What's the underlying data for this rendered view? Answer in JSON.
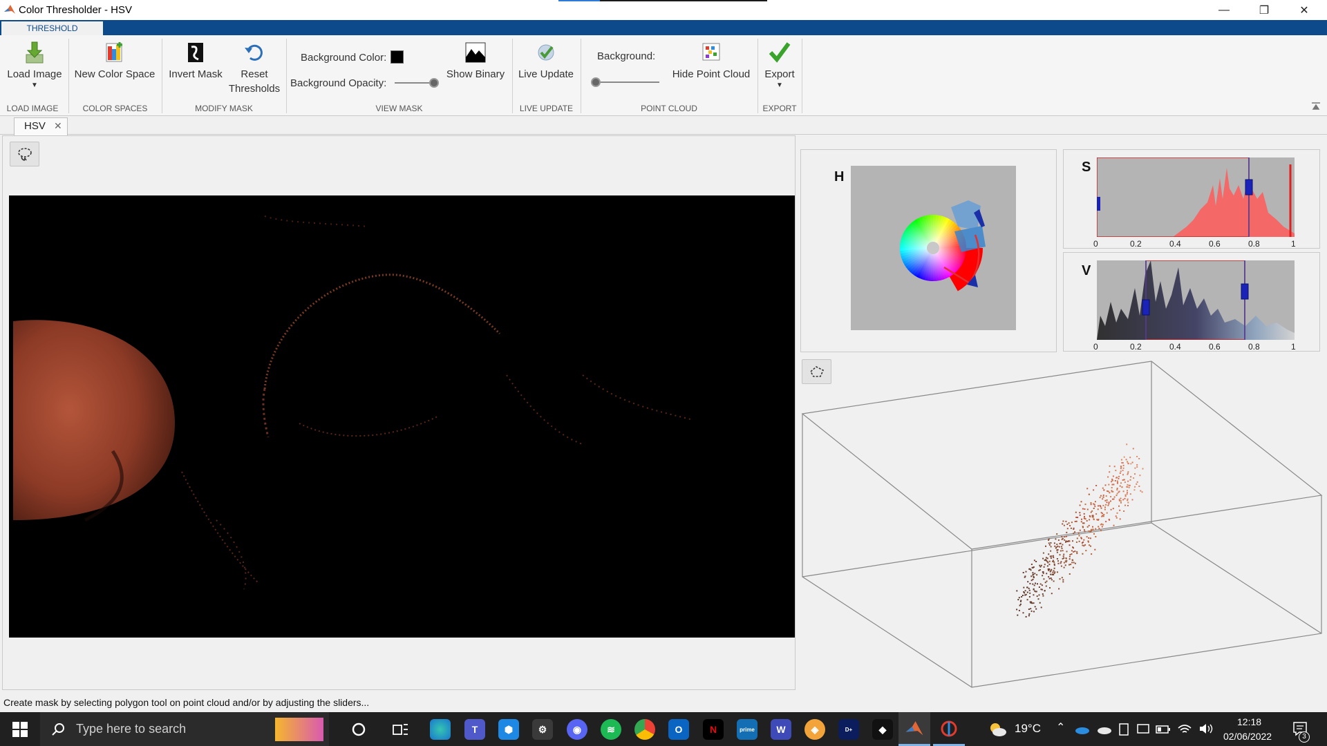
{
  "window": {
    "title": "Color Thresholder - HSV",
    "controls": {
      "minimize": "—",
      "restore": "❐",
      "close": "✕"
    }
  },
  "ribbon": {
    "tab": "THRESHOLD",
    "buttons": {
      "load_image": "Load Image",
      "new_color_space": "New Color Space",
      "invert_mask": "Invert Mask",
      "reset_thresholds_line1": "Reset",
      "reset_thresholds_line2": "Thresholds",
      "show_binary": "Show Binary",
      "live_update": "Live Update",
      "hide_point_cloud": "Hide Point Cloud",
      "export": "Export"
    },
    "labels": {
      "background_color": "Background Color:",
      "background_opacity": "Background Opacity:",
      "background": "Background:"
    },
    "groups": {
      "load_image": "LOAD IMAGE",
      "color_spaces": "COLOR SPACES",
      "modify_mask": "MODIFY MASK",
      "view_mask": "VIEW MASK",
      "live_update": "LIVE UPDATE",
      "point_cloud": "POINT CLOUD",
      "export": "EXPORT"
    },
    "background_color_value": "#000000",
    "background_opacity_value": 1.0,
    "point_cloud_background_value": 0.0
  },
  "document_tab": {
    "label": "HSV",
    "close": "✕"
  },
  "channels": {
    "h": {
      "label": "H"
    },
    "s": {
      "label": "S",
      "ticks": [
        "0",
        "0.2",
        "0.4",
        "0.6",
        "0.8",
        "1"
      ],
      "range": [
        0.0,
        0.77
      ]
    },
    "v": {
      "label": "V",
      "ticks": [
        "0",
        "0.2",
        "0.4",
        "0.6",
        "0.8",
        "1"
      ],
      "range": [
        0.25,
        0.75
      ]
    }
  },
  "status": {
    "text": "Create mask by selecting polygon tool on point cloud and/or by adjusting the sliders..."
  },
  "taskbar": {
    "search_placeholder": "Type here to search",
    "weather": "19°C",
    "time": "12:18",
    "date": "02/06/2022",
    "notification_count": "3"
  }
}
